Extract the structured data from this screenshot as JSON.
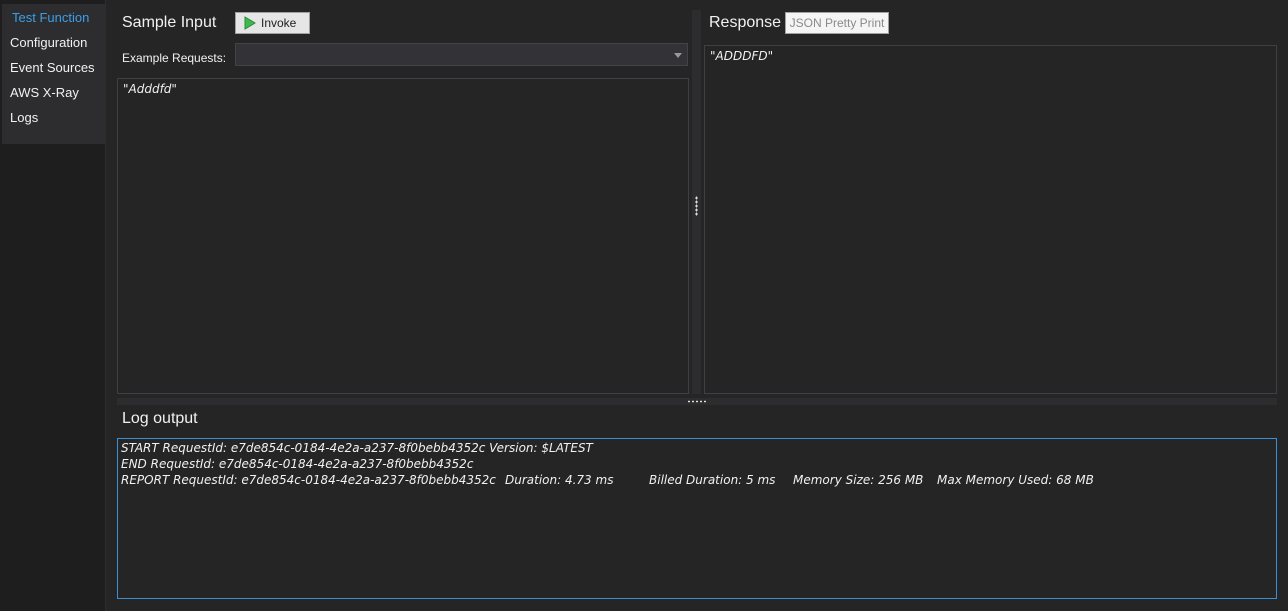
{
  "sidebar": {
    "items": [
      {
        "label": "Test Function",
        "active": true
      },
      {
        "label": "Configuration",
        "active": false
      },
      {
        "label": "Event Sources",
        "active": false
      },
      {
        "label": "AWS X-Ray",
        "active": false
      },
      {
        "label": "Logs",
        "active": false
      }
    ]
  },
  "input": {
    "title": "Sample Input",
    "invoke_label": "Invoke",
    "example_label": "Example Requests:",
    "example_selected": "",
    "body": "\"Adddfd\""
  },
  "response": {
    "title": "Response",
    "pretty_print_label": "JSON Pretty Print",
    "body": "\"ADDDFD\""
  },
  "log": {
    "title": "Log output",
    "start_line": "START RequestId: e7de854c-0184-4e2a-a237-8f0bebb4352c Version: $LATEST",
    "end_line": "END RequestId: e7de854c-0184-4e2a-a237-8f0bebb4352c",
    "report": {
      "request": "REPORT RequestId: e7de854c-0184-4e2a-a237-8f0bebb4352c",
      "duration": "Duration: 4.73 ms",
      "billed": "Billed Duration: 5 ms",
      "memory_size": "Memory Size: 256 MB",
      "max_memory": "Max Memory Used: 68 MB"
    }
  },
  "colors": {
    "accent": "#3b9fe8",
    "background": "#252526",
    "play_icon": "#3fb950"
  }
}
